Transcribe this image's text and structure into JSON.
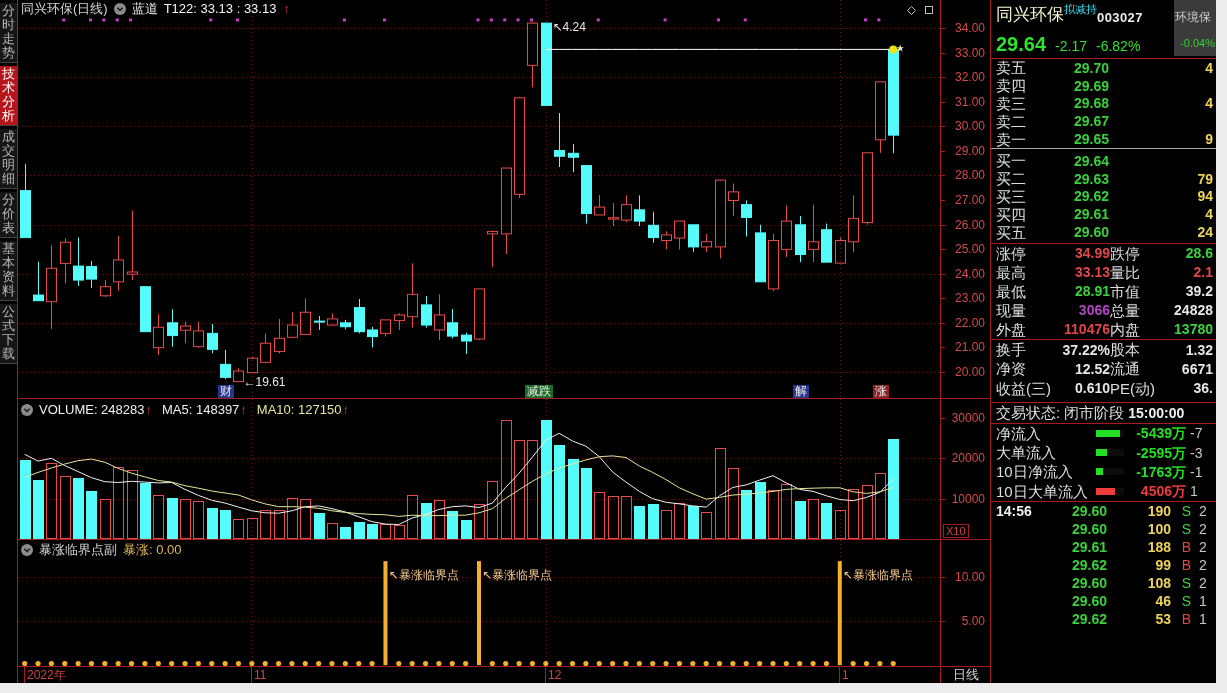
{
  "sidebar": {
    "tabs": [
      {
        "label": "分时走势",
        "selected": false
      },
      {
        "label": "技术分析",
        "selected": true
      },
      {
        "label": "成交明细",
        "selected": false
      },
      {
        "label": "分价表",
        "selected": false
      },
      {
        "label": "基本资料",
        "selected": false
      },
      {
        "label": "公式下载",
        "selected": false
      }
    ]
  },
  "price_pane": {
    "title": "同兴环保(日线)",
    "indicator": "蓝道",
    "reading": "T122: 33.13 : 33.13",
    "arrow": "↑",
    "event_tags": [
      {
        "label": "财",
        "color": "#26358c"
      },
      {
        "label": "减跌",
        "color": "#1d6b2a"
      },
      {
        "label": "解",
        "color": "#26358c"
      },
      {
        "label": "涨",
        "color": "#8a2424"
      }
    ],
    "chart_data": [
      {
        "type": "candlestick",
        "ylim": [
          18.94,
          35.14
        ],
        "yticks": [
          {
            "value": 20,
            "label": "20.00"
          },
          {
            "value": 21,
            "label": "21.00"
          },
          {
            "value": 22,
            "label": "22.00"
          },
          {
            "value": 23,
            "label": "23.00"
          },
          {
            "value": 24,
            "label": "24.00"
          },
          {
            "value": 25,
            "label": "25.00"
          },
          {
            "value": 26,
            "label": "26.00"
          },
          {
            "value": 27,
            "label": "27.00"
          },
          {
            "value": 28,
            "label": "28.00"
          },
          {
            "value": 29,
            "label": "29.00"
          },
          {
            "value": 30,
            "label": "30.00"
          },
          {
            "value": 31,
            "label": "31.00"
          },
          {
            "value": 32,
            "label": "32.00"
          },
          {
            "value": 33,
            "label": "33.00"
          },
          {
            "value": 34,
            "label": "34.00"
          }
        ],
        "tick_labels": "y",
        "grid": true,
        "annotations": [
          "↖4.24",
          "←19.61"
        ],
        "series": [
          {
            "type": "candlestick",
            "ohlc": [
              [
                27.38,
                28.46,
                25.47,
                25.47
              ],
              [
                23.13,
                24.49,
                22.9,
                22.9
              ],
              [
                22.86,
                25.17,
                21.75,
                24.22
              ],
              [
                24.42,
                25.44,
                23.61,
                25.28
              ],
              [
                24.31,
                25.47,
                23.5,
                23.74
              ],
              [
                24.29,
                24.52,
                23.41,
                23.78
              ],
              [
                23.1,
                23.74,
                23.06,
                23.47
              ],
              [
                23.67,
                25.53,
                23.3,
                24.56
              ],
              [
                23.98,
                26.57,
                23.74,
                24.07
              ],
              [
                23.47,
                23.5,
                21.64,
                21.64
              ],
              [
                20.99,
                22.35,
                20.69,
                21.82
              ],
              [
                22.0,
                22.55,
                21.03,
                21.48
              ],
              [
                21.7,
                22.05,
                21.17,
                21.87
              ],
              [
                21.03,
                22.05,
                21.0,
                21.67
              ],
              [
                21.57,
                21.95,
                20.76,
                20.92
              ],
              [
                20.31,
                20.9,
                19.7,
                19.78
              ],
              [
                19.61,
                20.15,
                19.61,
                20.04
              ],
              [
                19.97,
                20.62,
                19.95,
                20.56
              ],
              [
                20.39,
                21.57,
                20.35,
                21.17
              ],
              [
                20.83,
                22.16,
                20.76,
                21.37
              ],
              [
                21.41,
                22.43,
                21.38,
                21.91
              ],
              [
                21.53,
                23.0,
                21.5,
                22.43
              ],
              [
                22.07,
                22.28,
                21.71,
                22.03
              ],
              [
                21.91,
                22.39,
                21.87,
                22.16
              ],
              [
                22.0,
                22.12,
                21.74,
                21.84
              ],
              [
                22.62,
                22.97,
                21.57,
                21.64
              ],
              [
                21.71,
                21.84,
                21.0,
                21.44
              ],
              [
                21.57,
                22.14,
                21.44,
                22.12
              ],
              [
                22.09,
                22.39,
                21.71,
                22.32
              ],
              [
                22.25,
                24.42,
                21.8,
                23.16
              ],
              [
                22.73,
                23.09,
                21.8,
                21.91
              ],
              [
                21.71,
                23.16,
                21.3,
                22.32
              ],
              [
                22.0,
                22.56,
                21.37,
                21.46
              ],
              [
                21.5,
                21.6,
                20.73,
                21.26
              ],
              [
                21.34,
                23.4,
                21.3,
                23.38
              ],
              [
                25.62,
                25.75,
                24.27,
                25.72
              ],
              [
                25.62,
                28.3,
                24.8,
                28.3
              ],
              [
                27.23,
                31.2,
                27.08,
                31.16
              ],
              [
                32.48,
                34.24,
                31.58,
                34.2
              ],
              [
                34.2,
                34.2,
                30.85,
                30.85
              ],
              [
                29.01,
                30.54,
                28.34,
                28.78
              ],
              [
                28.9,
                29.28,
                28.14,
                28.74
              ],
              [
                28.4,
                28.4,
                26.04,
                26.45
              ],
              [
                26.39,
                27.2,
                26.39,
                26.71
              ],
              [
                26.22,
                26.88,
                25.94,
                26.28
              ],
              [
                26.18,
                27.19,
                26.1,
                26.81
              ],
              [
                26.6,
                27.19,
                25.94,
                26.14
              ],
              [
                25.97,
                26.52,
                25.26,
                25.47
              ],
              [
                25.35,
                25.72,
                24.99,
                25.58
              ],
              [
                25.45,
                26.14,
                24.99,
                26.14
              ],
              [
                25.99,
                25.99,
                24.88,
                25.09
              ],
              [
                25.09,
                25.62,
                24.88,
                25.3
              ],
              [
                25.09,
                27.81,
                24.62,
                27.81
              ],
              [
                26.98,
                27.67,
                26.35,
                27.33
              ],
              [
                26.81,
                26.98,
                25.51,
                26.29
              ],
              [
                25.66,
                25.99,
                23.67,
                23.67
              ],
              [
                23.38,
                25.62,
                23.3,
                25.35
              ],
              [
                24.99,
                26.77,
                24.68,
                26.14
              ],
              [
                25.99,
                26.35,
                24.47,
                24.78
              ],
              [
                24.99,
                26.81,
                24.47,
                25.3
              ],
              [
                25.79,
                26.04,
                24.47,
                24.47
              ],
              [
                24.43,
                25.47,
                24.43,
                25.35
              ],
              [
                25.3,
                27.19,
                24.88,
                26.25
              ],
              [
                26.08,
                28.92,
                26.0,
                28.92
              ],
              [
                29.45,
                31.81,
                28.92,
                31.81
              ],
              [
                33.13,
                33.13,
                28.91,
                29.64
              ],
              null,
              null,
              null
            ]
          },
          {
            "type": "line",
            "color": "#ffffff",
            "values": [
              null,
              null,
              null,
              null,
              null,
              null,
              null,
              null,
              null,
              null,
              null,
              null,
              null,
              null,
              null,
              null,
              null,
              null,
              null,
              null,
              null,
              null,
              null,
              null,
              null,
              null,
              null,
              null,
              null,
              null,
              null,
              null,
              null,
              null,
              null,
              null,
              null,
              null,
              null,
              33.13,
              33.13,
              33.13,
              33.13,
              33.13,
              33.13,
              33.13,
              33.13,
              33.13,
              33.13,
              33.13,
              33.13,
              33.13,
              33.13,
              33.13,
              33.13,
              33.13,
              33.13,
              33.13,
              33.13,
              33.13,
              33.13,
              33.13,
              33.13,
              33.13,
              33.13,
              33.13,
              null,
              null,
              null
            ]
          },
          {
            "type": "scatter",
            "marker": "square",
            "color": "#c63ec6",
            "values": [
              null,
              null,
              null,
              34.33,
              null,
              34.33,
              34.33,
              34.33,
              34.33,
              null,
              null,
              null,
              null,
              null,
              34.33,
              null,
              34.33,
              null,
              null,
              null,
              null,
              null,
              null,
              null,
              34.33,
              null,
              null,
              34.33,
              null,
              null,
              null,
              null,
              null,
              null,
              34.33,
              34.33,
              34.33,
              34.33,
              34.33,
              null,
              null,
              null,
              null,
              34.33,
              null,
              null,
              null,
              null,
              34.33,
              null,
              null,
              null,
              34.33,
              null,
              34.33,
              null,
              null,
              null,
              null,
              null,
              null,
              null,
              null,
              34.33,
              34.33,
              null,
              null,
              null,
              null
            ]
          }
        ]
      }
    ]
  },
  "volume_pane": {
    "legend": [
      {
        "text": "VOLUME: 248283",
        "arrow": "↑",
        "color": "#f0f0f0"
      },
      {
        "text": "MA5: 148397",
        "arrow": "↑",
        "color": "#f0f0f0"
      },
      {
        "text": "MA10: 127150",
        "arrow": "↑",
        "color": "#e6e69a"
      }
    ],
    "axis_unit": "X10",
    "chart_data": [
      {
        "type": "bar",
        "ylim": [
          0,
          34700
        ],
        "yticks": [
          10000,
          20000,
          30000
        ],
        "tick_labels": "y",
        "grid": true,
        "series": [
          {
            "type": "bar",
            "color": "#54fcfc",
            "values": [
              19500,
              14500,
              null,
              null,
              15000,
              11800,
              null,
              null,
              null,
              13900,
              null,
              10100,
              null,
              null,
              7800,
              7300,
              null,
              null,
              null,
              null,
              null,
              null,
              6400,
              null,
              3000,
              4300,
              3600,
              null,
              null,
              null,
              9000,
              null,
              7000,
              4600,
              null,
              null,
              null,
              null,
              null,
              29400,
              23200,
              19900,
              17700,
              null,
              null,
              null,
              8200,
              8700,
              null,
              null,
              8200,
              null,
              null,
              null,
              12100,
              14100,
              null,
              null,
              9300,
              null,
              8800,
              null,
              null,
              null,
              null,
              24800,
              null,
              null,
              null
            ]
          },
          {
            "type": "bar",
            "color": "#e84a4a",
            "values": [
              null,
              null,
              18900,
              15700,
              null,
              null,
              9800,
              17900,
              17000,
              null,
              10900,
              null,
              9800,
              9500,
              null,
              null,
              5000,
              5300,
              7300,
              7300,
              10200,
              9800,
              null,
              4000,
              null,
              null,
              null,
              3600,
              3400,
              10900,
              null,
              9700,
              null,
              null,
              8700,
              14300,
              29400,
              24600,
              24600,
              null,
              null,
              null,
              null,
              11700,
              10700,
              10700,
              null,
              null,
              7100,
              8900,
              null,
              6600,
              22600,
              17500,
              null,
              null,
              12100,
              13700,
              null,
              9800,
              null,
              7200,
              12500,
              13300,
              16300,
              null,
              null,
              null,
              null
            ]
          },
          {
            "type": "line",
            "color": "#f0f0f0",
            "values": [
              21000,
              19300,
              20000,
              18200,
              16700,
              15200,
              14200,
              14000,
              14300,
              14100,
              13900,
              14000,
              12300,
              10800,
              9600,
              8900,
              7900,
              7000,
              6500,
              6400,
              7000,
              8000,
              8200,
              7500,
              6700,
              5500,
              4300,
              3700,
              3600,
              5200,
              6100,
              7300,
              8000,
              8200,
              7800,
              8900,
              12800,
              16300,
              20300,
              24500,
              26200,
              24300,
              23000,
              20400,
              16600,
              14100,
              11800,
              10000,
              9100,
              8700,
              8200,
              7900,
              10700,
              12800,
              13400,
              14600,
              15700,
              13900,
              12300,
              11800,
              10700,
              9800,
              9500,
              10300,
              11600,
              14800,
              null,
              null,
              null
            ]
          },
          {
            "type": "line",
            "color": "#e6e69a",
            "values": [
              15300,
              16500,
              17600,
              18600,
              19400,
              19800,
              19000,
              17500,
              16300,
              15400,
              14500,
              14100,
              13200,
              12600,
              11900,
              11400,
              10900,
              9700,
              8700,
              8000,
              8000,
              7900,
              7600,
              7000,
              6600,
              6300,
              6100,
              6000,
              5600,
              5900,
              5800,
              5800,
              5900,
              5900,
              6500,
              7500,
              10100,
              12200,
              14300,
              16100,
              17600,
              18600,
              19600,
              20400,
              20600,
              20200,
              18100,
              16500,
              14700,
              12700,
              11200,
              9900,
              10300,
              10900,
              11100,
              11400,
              11800,
              12300,
              12500,
              12600,
              12700,
              12700,
              11700,
              11300,
              11700,
              12800,
              null,
              null,
              null
            ]
          }
        ]
      }
    ]
  },
  "indicator_pane": {
    "title": "暴涨临界点副",
    "reading": "暴涨: 0.00",
    "chart_data": [
      {
        "type": "bar",
        "ylim": [
          -0.1,
          14.2
        ],
        "yticks": [
          {
            "value": 5,
            "label": "5.00"
          },
          {
            "value": 10,
            "label": "10.00"
          }
        ],
        "tick_labels": "y",
        "grid": true,
        "color": "#f5b02c",
        "marker": "circle",
        "annotations": [
          "↖暴涨临界点",
          "↖暴涨临界点",
          "↖暴涨临界点"
        ],
        "values": [
          0,
          0,
          0,
          0,
          0,
          0,
          0,
          0,
          0,
          0,
          0,
          0,
          0,
          0,
          0,
          0,
          0,
          0,
          0,
          0,
          0,
          0,
          0,
          0,
          0,
          0,
          0,
          11.8,
          0,
          0,
          0,
          0,
          0,
          0,
          11.8,
          0,
          0,
          0,
          0,
          0,
          0,
          0,
          0,
          0,
          0,
          0,
          0,
          0,
          0,
          0,
          0,
          0,
          0,
          0,
          0,
          0,
          0,
          0,
          0,
          0,
          0,
          11.8,
          0,
          0,
          0,
          0,
          null,
          null,
          null
        ]
      }
    ]
  },
  "date_axis": [
    "2022年",
    "11",
    "12",
    "1"
  ],
  "period_label": "日线",
  "quote": {
    "name": "同兴环保",
    "badge": "拟减持",
    "code": "003027",
    "sector": "环境保",
    "sector_change": "-0.04%",
    "price": "29.64",
    "change": "-2.17",
    "change_pct": "-6.82%",
    "asks": [
      {
        "label": "卖五",
        "price": "29.70",
        "volume": "4"
      },
      {
        "label": "卖四",
        "price": "29.69"
      },
      {
        "label": "卖三",
        "price": "29.68",
        "volume": "4"
      },
      {
        "label": "卖二",
        "price": "29.67"
      },
      {
        "label": "卖一",
        "price": "29.65",
        "volume": "9"
      }
    ],
    "bids": [
      {
        "label": "买一",
        "price": "29.64"
      },
      {
        "label": "买二",
        "price": "29.63",
        "volume": "79"
      },
      {
        "label": "买三",
        "price": "29.62",
        "volume": "94"
      },
      {
        "label": "买四",
        "price": "29.61",
        "volume": "4"
      },
      {
        "label": "买五",
        "price": "29.60",
        "volume": "24"
      }
    ],
    "stats": [
      [
        {
          "label": "涨停",
          "value": "34.99",
          "color": "#e04848"
        },
        {
          "label": "跌停",
          "value": "28.6",
          "color": "#3cd23c"
        }
      ],
      [
        {
          "label": "最高",
          "value": "33.13",
          "color": "#e04848"
        },
        {
          "label": "量比",
          "value": "2.1",
          "color": "#e04848"
        }
      ],
      [
        {
          "label": "最低",
          "value": "28.91",
          "color": "#3cd23c"
        },
        {
          "label": "市值",
          "value": "39.2",
          "color": "#e6e6e6"
        }
      ],
      [
        {
          "label": "现量",
          "value": "3066",
          "color": "#b246c4"
        },
        {
          "label": "总量",
          "value": "24828",
          "color": "#e6e6e6"
        }
      ],
      [
        {
          "label": "外盘",
          "value": "110476",
          "color": "#e04848"
        },
        {
          "label": "内盘",
          "value": "13780",
          "color": "#3cd23c"
        }
      ]
    ],
    "fundamentals": [
      [
        {
          "label": "换手",
          "value": "37.22%"
        },
        {
          "label": "股本",
          "value": "1.32"
        }
      ],
      [
        {
          "label": "净资",
          "value": "12.52"
        },
        {
          "label": "流通",
          "value": "6671"
        }
      ],
      [
        {
          "label": "收益(三)",
          "value": "0.610"
        },
        {
          "label": "PE(动)",
          "value": "36."
        }
      ]
    ],
    "trade_status": {
      "label": "交易状态:",
      "value": "闭市阶段",
      "time": "15:00:00"
    },
    "money_flow": [
      {
        "label": "净流入",
        "level": 0.86,
        "color": "#22e022",
        "value": "-5439万",
        "column_4": "-7"
      },
      {
        "label": "大单流入",
        "level": 0.38,
        "color": "#22e022",
        "value": "-2595万",
        "column_4": "-3"
      },
      {
        "label": "10日净流入",
        "level": 0.25,
        "color": "#22e022",
        "value": "-1763万",
        "column_4": "-1"
      },
      {
        "label": "10日大单流入",
        "level": 0.68,
        "color": "#ee3c3c",
        "value": "4506万",
        "column_4": "1"
      }
    ],
    "ticks": [
      {
        "time": "14:56",
        "price": "29.60",
        "volume": "190",
        "side": "S",
        "color": "#3cd23c",
        "column_5": "2"
      },
      {
        "price": "29.60",
        "volume": "100",
        "side": "S",
        "color": "#3cd23c",
        "column_5": "2"
      },
      {
        "price": "29.61",
        "volume": "188",
        "side": "B",
        "color": "#e04848",
        "column_5": "2"
      },
      {
        "price": "29.62",
        "volume": "99",
        "side": "B",
        "color": "#e04848",
        "column_5": "2"
      },
      {
        "price": "29.60",
        "volume": "108",
        "side": "S",
        "color": "#3cd23c",
        "column_5": "2"
      },
      {
        "price": "29.60",
        "volume": "46",
        "side": "S",
        "color": "#3cd23c",
        "column_5": "1"
      },
      {
        "price": "29.62",
        "volume": "53",
        "side": "B",
        "color": "#e04848",
        "column_5": "1"
      }
    ]
  }
}
